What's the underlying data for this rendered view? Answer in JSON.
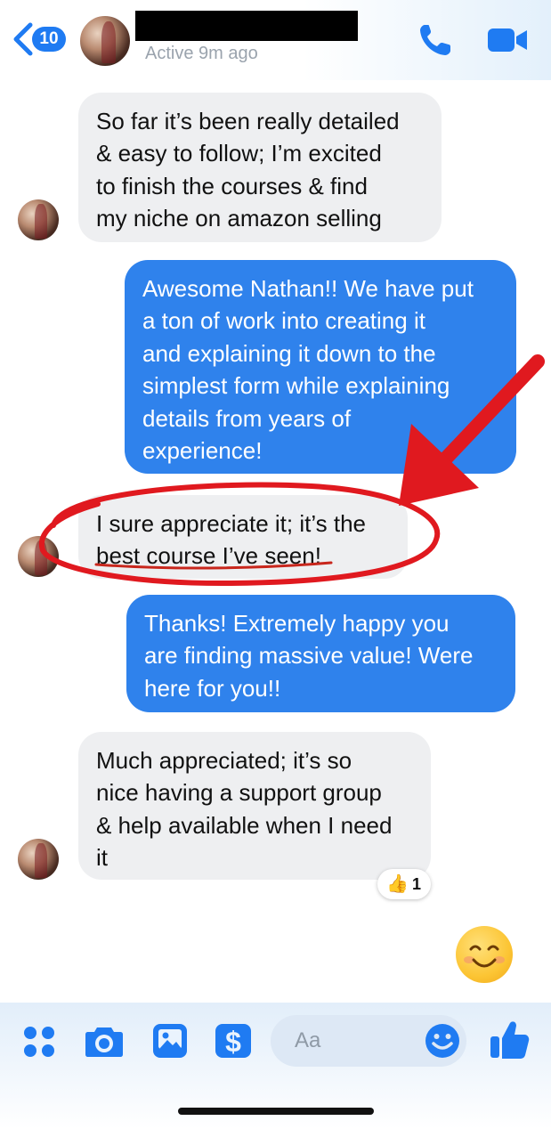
{
  "header": {
    "unread_count": "10",
    "status": "Active 9m ago",
    "icons": [
      "back-chevron-icon",
      "phone-icon",
      "video-camera-icon"
    ]
  },
  "messages": [
    {
      "direction": "incoming",
      "lines": [
        "So far it’s been really detailed",
        "& easy to follow; I’m excited",
        "to finish the courses & find",
        "my niche on amazon selling"
      ]
    },
    {
      "direction": "outgoing",
      "lines": [
        "Awesome Nathan!! We have put",
        "a ton of work into creating it",
        "and explaining it down to the",
        "simplest form while explaining",
        "details from years of",
        "experience!"
      ]
    },
    {
      "direction": "incoming",
      "lines": [
        "I sure appreciate it; it’s the",
        "best course I’ve seen!"
      ]
    },
    {
      "direction": "outgoing",
      "lines": [
        "Thanks! Extremely happy you",
        "are finding massive value! Were",
        "here for you!!"
      ]
    },
    {
      "direction": "incoming",
      "lines": [
        "Much appreciated; it’s so",
        "nice having a support group",
        "& help available when I need",
        "it"
      ],
      "reaction": {
        "emoji": "👍",
        "count": "1"
      }
    }
  ],
  "sent_emoji": "smiling-face-emoji",
  "composer": {
    "placeholder": "Aa",
    "icons": [
      "apps-grid-icon",
      "camera-icon",
      "photo-icon",
      "dollar-icon",
      "emoji-icon",
      "thumbs-up-icon"
    ]
  },
  "colors": {
    "accent": "#1f7bf2",
    "outgoing_bubble": "#2f82ec",
    "incoming_bubble": "#eeeff1",
    "annotation": "#e0191f"
  }
}
